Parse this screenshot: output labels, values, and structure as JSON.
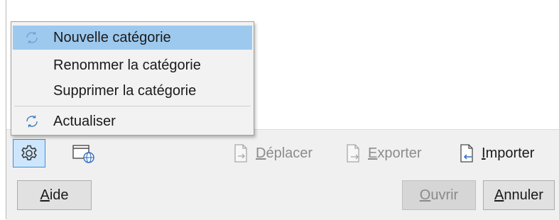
{
  "context_menu": {
    "items": [
      {
        "label": "Nouvelle catégorie",
        "icon": "refresh-icon",
        "highlighted": true
      },
      {
        "label": "Renommer la catégorie"
      },
      {
        "label": "Supprimer la catégorie"
      },
      {
        "label": "Actualiser",
        "icon": "refresh-icon"
      }
    ]
  },
  "toolbar": {
    "settings_icon": "gear-icon",
    "web_icon": "window-globe-icon",
    "move": {
      "mnemonic": "D",
      "rest": "éplacer",
      "enabled": false,
      "icon": "move-document-icon"
    },
    "export": {
      "mnemonic": "E",
      "rest": "xporter",
      "enabled": false,
      "icon": "export-document-icon"
    },
    "import": {
      "mnemonic": "I",
      "rest": "mporter",
      "enabled": true,
      "icon": "import-document-icon"
    }
  },
  "buttons": {
    "help": {
      "mnemonic": "A",
      "rest": "ide"
    },
    "open": {
      "mnemonic": "O",
      "rest": "uvrir",
      "enabled": false
    },
    "cancel": {
      "mnemonic": "A",
      "rest": "nnuler"
    }
  },
  "colors": {
    "menu_highlight": "#9ec9ee",
    "selected_button_bg": "#cde6fb",
    "selected_button_border": "#3d8ee3",
    "icon_blue": "#4a90d9"
  }
}
